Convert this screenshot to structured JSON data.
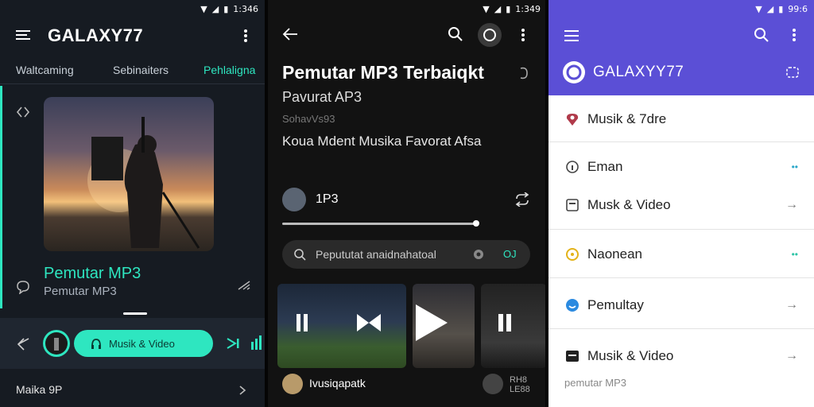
{
  "status": {
    "time_left": "1:346",
    "time_mid": "1:349",
    "time_right": "99:6"
  },
  "panel_left": {
    "app_title": "GALAXY77",
    "tabs": [
      "Waltcaming",
      "Sebinaiters",
      "Pehlaligna"
    ],
    "song_title": "Pemutar MP3",
    "song_subtitle": "Pemutar MP3",
    "pill_label": "Musik & Video",
    "bottom_item": "Maika 9P",
    "accent": "#2ee6c0"
  },
  "panel_middle": {
    "title": "Pemutar MP3 Terbaiqkt",
    "subtitle": "Pavurat AP3",
    "meta": "SohavVs93",
    "tagline": "Koua Mdent Musika Favorat Afsa",
    "track_label": "1P3",
    "search_text": "Pepututat anaidnahatoal",
    "search_badge": "OJ",
    "mini_label": "Ivusiqapatk",
    "mini_label2_a": "RH8",
    "mini_label2_b": "LE88"
  },
  "panel_right": {
    "brand": "GALAXYY77",
    "header_color": "#5b4fd6",
    "items": [
      {
        "label": "Musik & 7dre",
        "icon": "heart-pin-icon",
        "trail": ""
      },
      {
        "label": "Eman",
        "icon": "circle-info-icon",
        "trail": "••"
      },
      {
        "label": "Musk & Video",
        "icon": "book-icon",
        "trail": "→"
      },
      {
        "label": "Naonean",
        "icon": "sun-icon",
        "trail": "••"
      },
      {
        "label": "Pemultay",
        "icon": "smile-icon",
        "trail": "→"
      },
      {
        "label": "Musik & Video",
        "icon": "video-icon",
        "trail": "→"
      }
    ],
    "footer": "pemutar MP3"
  }
}
